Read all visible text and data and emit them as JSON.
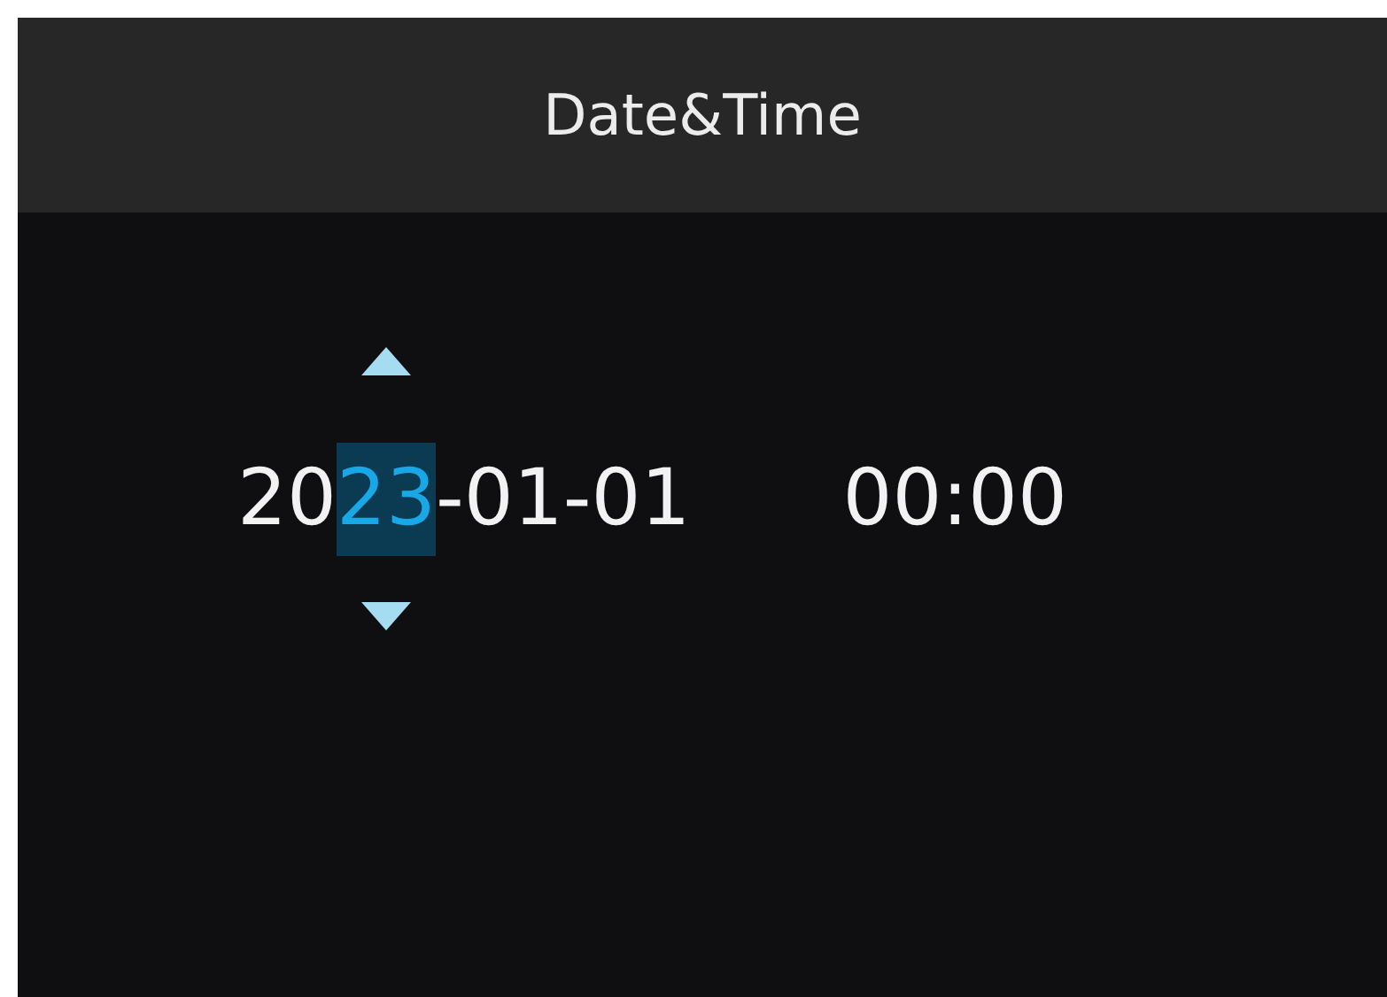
{
  "header": {
    "title": "Date&Time"
  },
  "date_segments": [
    {
      "text": "20",
      "selected": false
    },
    {
      "text": "23",
      "selected": true
    },
    {
      "text": "-01-01",
      "selected": false
    }
  ],
  "time": "00:00"
}
